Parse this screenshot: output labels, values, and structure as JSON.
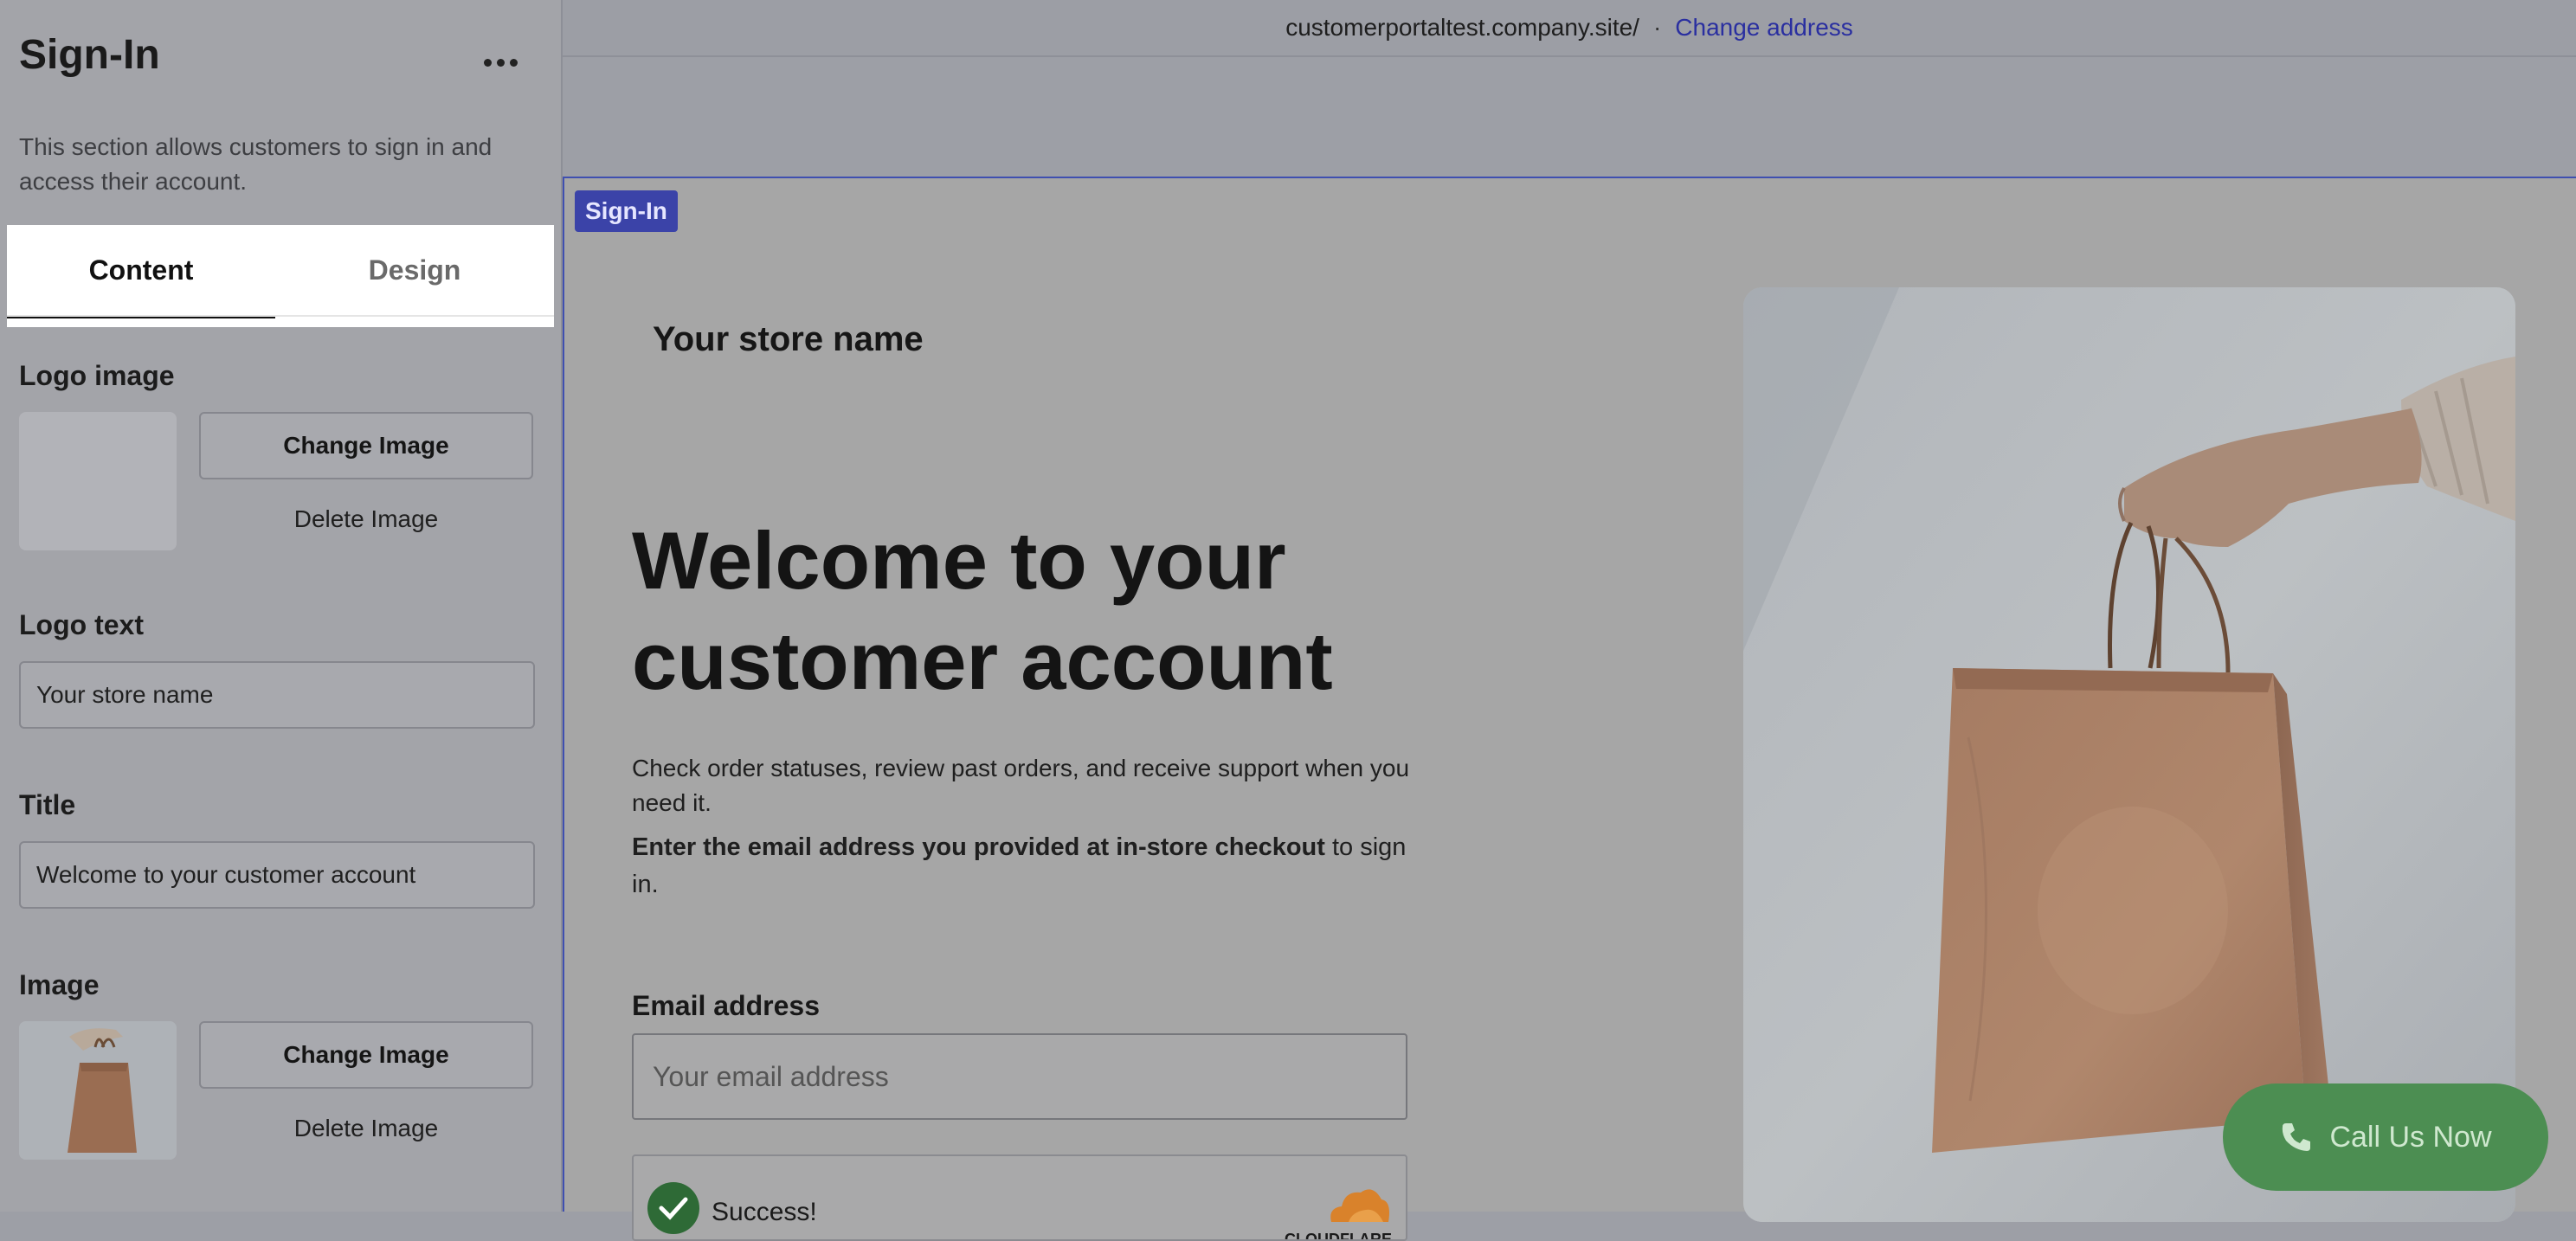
{
  "topbar": {
    "url": "customerportaltest.company.site/",
    "separator": "·",
    "change_address": "Change address"
  },
  "sidebar": {
    "title": "Sign-In",
    "description": "This section allows customers to sign in and access their account.",
    "tabs": [
      {
        "label": "Content",
        "active": true
      },
      {
        "label": "Design",
        "active": false
      }
    ],
    "logo_image": {
      "label": "Logo image",
      "change": "Change Image",
      "delete": "Delete Image"
    },
    "logo_text": {
      "label": "Logo text",
      "value": "Your store name"
    },
    "title_field": {
      "label": "Title",
      "value": "Welcome to your customer account"
    },
    "image": {
      "label": "Image",
      "change": "Change Image",
      "delete": "Delete Image"
    }
  },
  "preview": {
    "section_tag": "Sign-In",
    "store_name": "Your store name",
    "heading": "Welcome to your customer account",
    "subtext": "Check order statuses, review past orders, and receive support when you need it.",
    "instruction_bold": "Enter the email address you provided at in-store checkout",
    "instruction_rest": " to sign in.",
    "email_label": "Email address",
    "email_placeholder": "Your email address",
    "captcha_status": "Success!",
    "captcha_brand": "CLOUDFLARE"
  },
  "call_button": {
    "label": "Call Us Now"
  },
  "colors": {
    "accent_blue": "#3b43a8",
    "link_blue": "#2a2fa0",
    "call_green": "#4c8e52"
  }
}
